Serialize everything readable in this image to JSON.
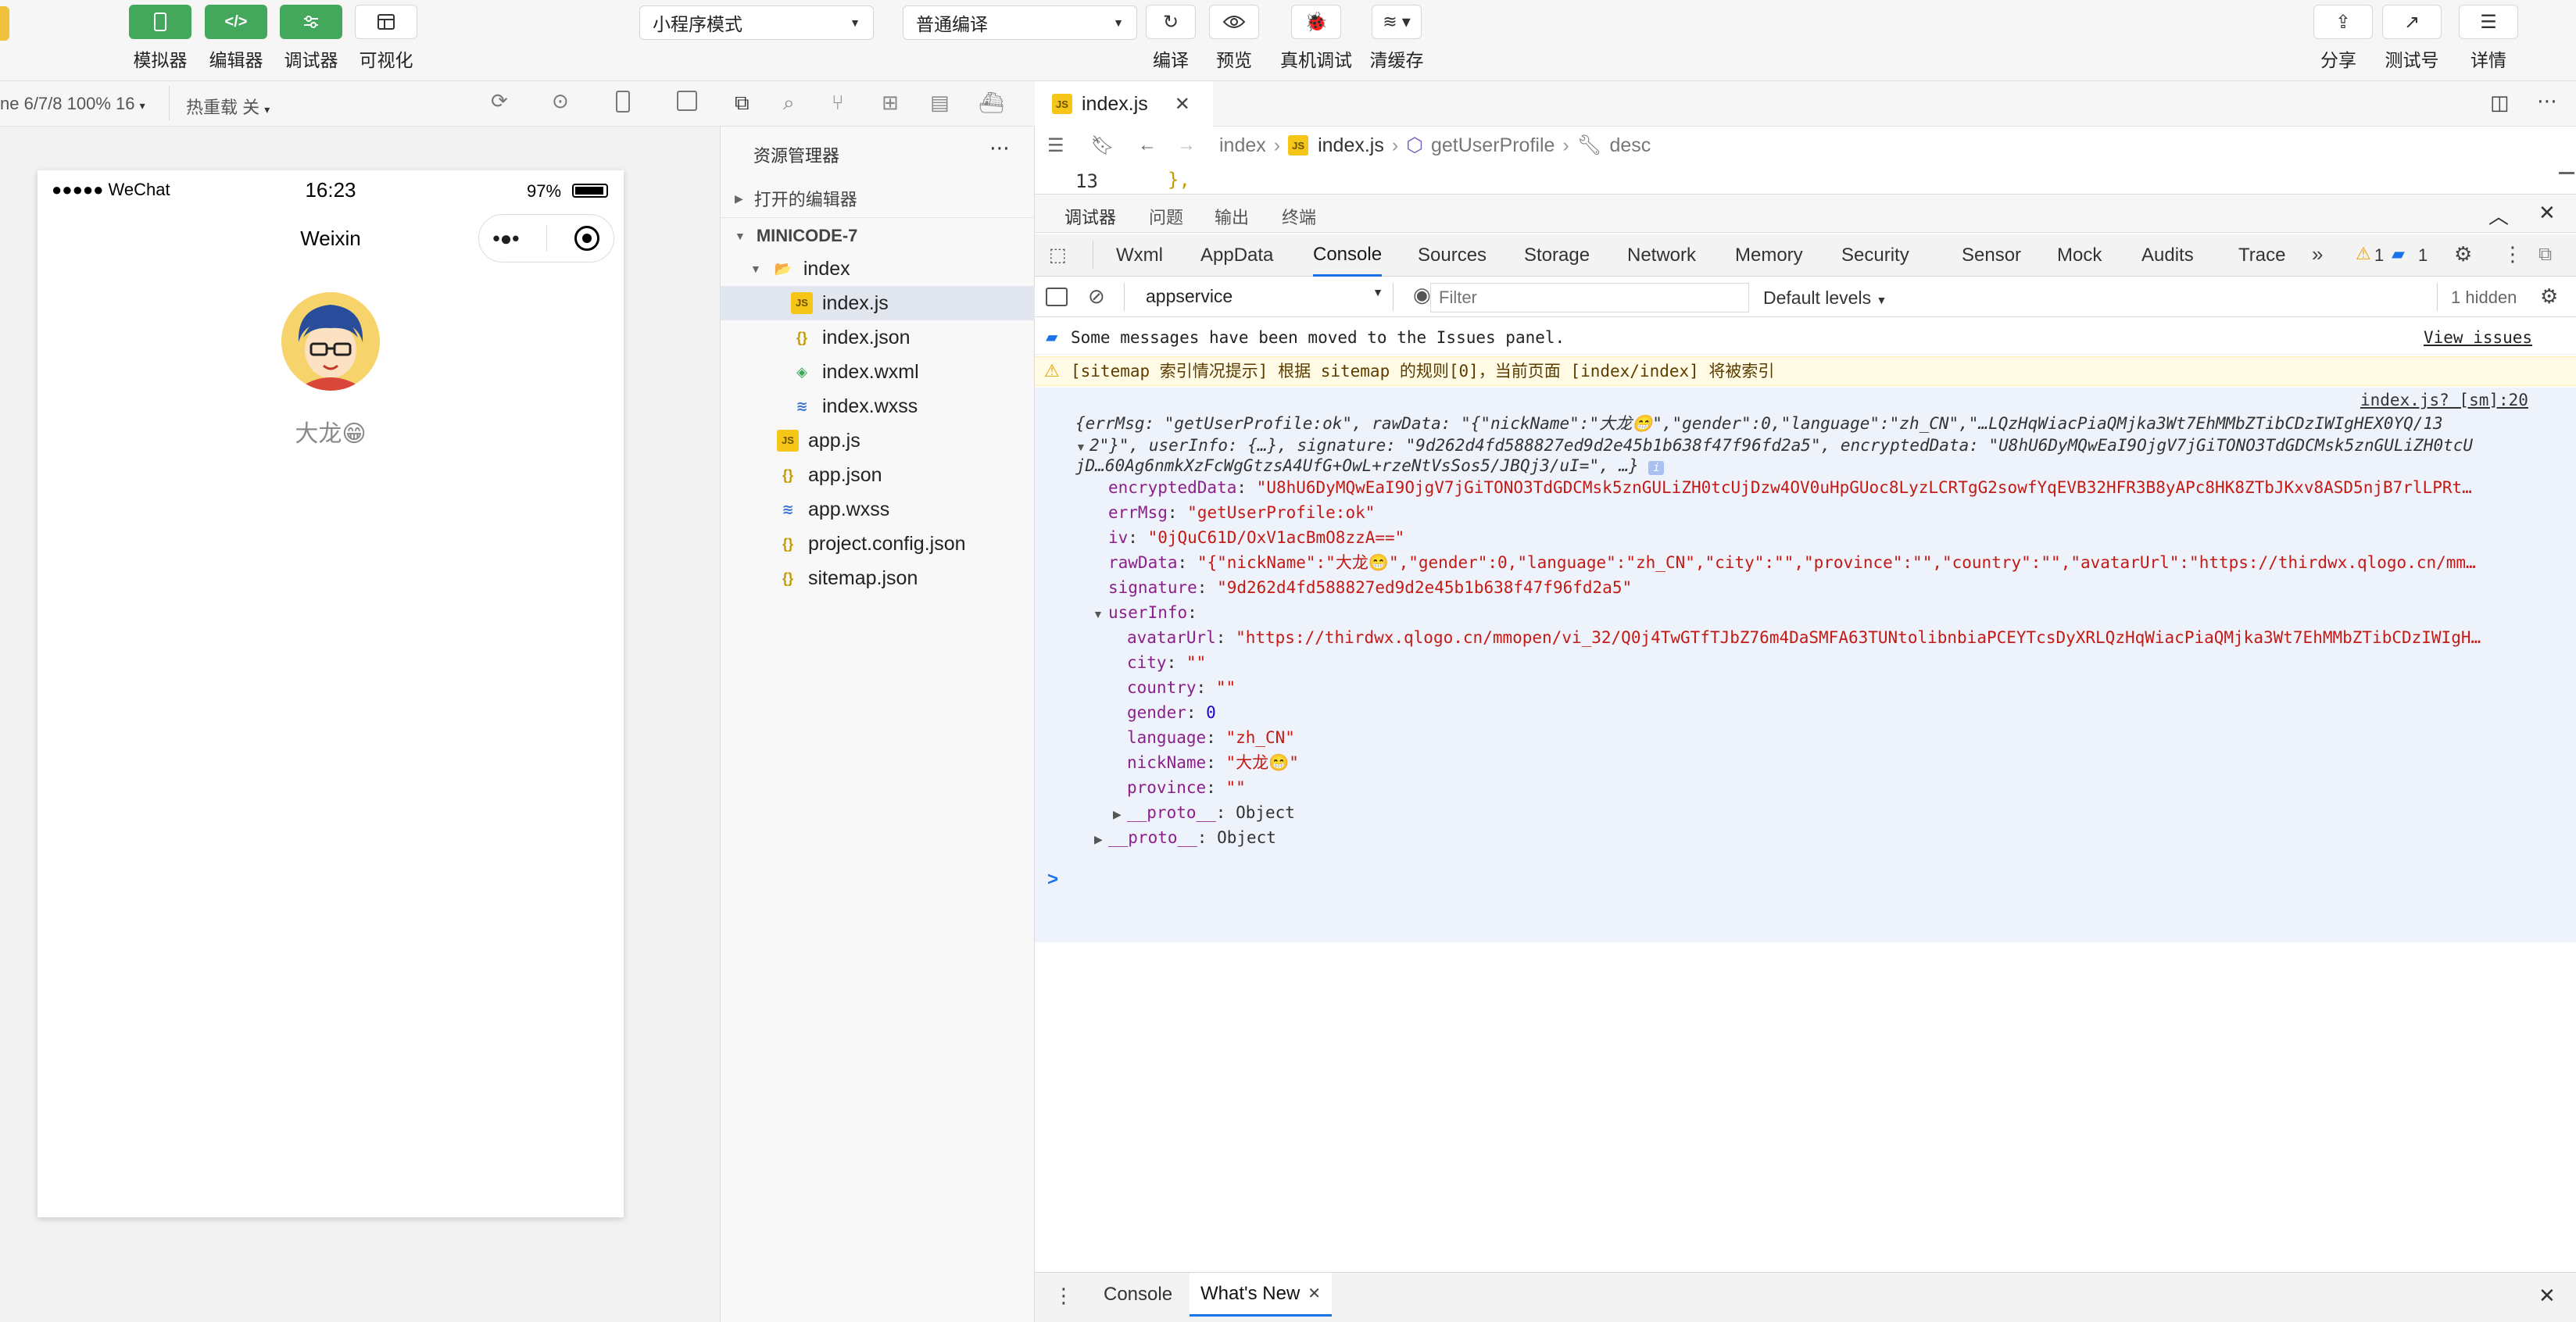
{
  "toolbar": {
    "simulator": "模拟器",
    "editor": "编辑器",
    "debugger": "调试器",
    "visual": "可视化",
    "mode_select": "小程序模式",
    "compile_select": "普通编译",
    "compile": "编译",
    "preview": "预览",
    "real_debug": "真机调试",
    "clear_cache": "清缓存",
    "share": "分享",
    "test_account": "测试号",
    "details": "详情"
  },
  "sim": {
    "device": "ne 6/7/8 100% 16",
    "hot_reload": "热重载 关",
    "status_signal": "●●●●● WeChat",
    "status_time": "16:23",
    "status_battery": "97%",
    "nav_title": "Weixin",
    "nickname": "大龙😁"
  },
  "explorer": {
    "title": "资源管理器",
    "open_editors": "打开的编辑器",
    "project": "MINICODE-7",
    "items": [
      {
        "label": "index",
        "kind": "folder"
      },
      {
        "label": "index.js",
        "kind": "js"
      },
      {
        "label": "index.json",
        "kind": "json"
      },
      {
        "label": "index.wxml",
        "kind": "wxml"
      },
      {
        "label": "index.wxss",
        "kind": "wxss"
      },
      {
        "label": "app.js",
        "kind": "js"
      },
      {
        "label": "app.json",
        "kind": "json"
      },
      {
        "label": "app.wxss",
        "kind": "wxss"
      },
      {
        "label": "project.config.json",
        "kind": "json"
      },
      {
        "label": "sitemap.json",
        "kind": "json"
      }
    ]
  },
  "editor": {
    "tab": "index.js",
    "breadcrumb": [
      "index",
      "index.js",
      "getUserProfile",
      "desc"
    ],
    "line_no": "13",
    "line_code": "},"
  },
  "devtools": {
    "top_tabs": [
      "调试器",
      "问题",
      "输出",
      "终端"
    ],
    "tabs": [
      "Wxml",
      "AppData",
      "Console",
      "Sources",
      "Storage",
      "Network",
      "Memory",
      "Security",
      "Sensor",
      "Mock",
      "Audits",
      "Trace"
    ],
    "warn_count": "1",
    "info_count": "1",
    "context": "appservice",
    "filter_placeholder": "Filter",
    "levels": "Default levels",
    "hidden": "1 hidden",
    "issues_msg": "Some messages have been moved to the Issues panel.",
    "view_issues": "View issues",
    "sitemap_msg": "[sitemap 索引情况提示] 根据 sitemap 的规则[0]，当前页面 [index/index] 将被索引",
    "source_link": "index.js? [sm]:20",
    "summary_1": "{errMsg: \"getUserProfile:ok\", rawData: \"{\"nickName\":\"大龙😁\",\"gender\":0,\"language\":\"zh_CN\",\"…LQzHqWiacPiaQMjka3Wt7EhMMbZTibCDzIWIgHEX0YQ/13",
    "summary_2": "2\"}\", userInfo: {…}, signature: \"9d262d4fd588827ed9d2e45b1b638f47f96fd2a5\", encryptedData: \"U8hU6DyMQwEaI9OjgV7jGiTONO3TdGDCMsk5znGULiZH0tcU",
    "summary_3": "jD…60Ag6nmkXzFcWgGtzsA4UfG+OwL+rzeNtVsSos5/JBQj3/uI=\", …}",
    "props": [
      {
        "key": "encryptedData",
        "value": "\"U8hU6DyMQwEaI9OjgV7jGiTONO3TdGDCMsk5znGULiZH0tcUjDzw4OV0uHpGUoc8LyzLCRTgG2sowfYqEVB32HFR3B8yAPc8HK8ZTbJKxv8ASD5njB7rlLPRt…"
      },
      {
        "key": "errMsg",
        "value": "\"getUserProfile:ok\""
      },
      {
        "key": "iv",
        "value": "\"0jQuC61D/OxV1acBmO8zzA==\""
      },
      {
        "key": "rawData",
        "value": "\"{\"nickName\":\"大龙😁\",\"gender\":0,\"language\":\"zh_CN\",\"city\":\"\",\"province\":\"\",\"country\":\"\",\"avatarUrl\":\"https://thirdwx.qlogo.cn/mm…"
      },
      {
        "key": "signature",
        "value": "\"9d262d4fd588827ed9d2e45b1b638f47f96fd2a5\""
      }
    ],
    "userinfo_key": "userInfo",
    "userinfo": [
      {
        "key": "avatarUrl",
        "value": "\"https://thirdwx.qlogo.cn/mmopen/vi_32/Q0j4TwGTfTJbZ76m4DaSMFA63TUNtolibnbiaPCEYTcsDyXRLQzHqWiacPiaQMjka3Wt7EhMMbZTibCDzIWIgH…"
      },
      {
        "key": "city",
        "value": "\"\""
      },
      {
        "key": "country",
        "value": "\"\""
      },
      {
        "key": "gender",
        "value": "0"
      },
      {
        "key": "language",
        "value": "\"zh_CN\""
      },
      {
        "key": "nickName",
        "value": "\"大龙😁\""
      },
      {
        "key": "province",
        "value": "\"\""
      }
    ],
    "proto_key": "__proto__",
    "proto_val": "Object",
    "prompt": ">",
    "drawer_tabs": [
      "Console",
      "What's New"
    ]
  }
}
